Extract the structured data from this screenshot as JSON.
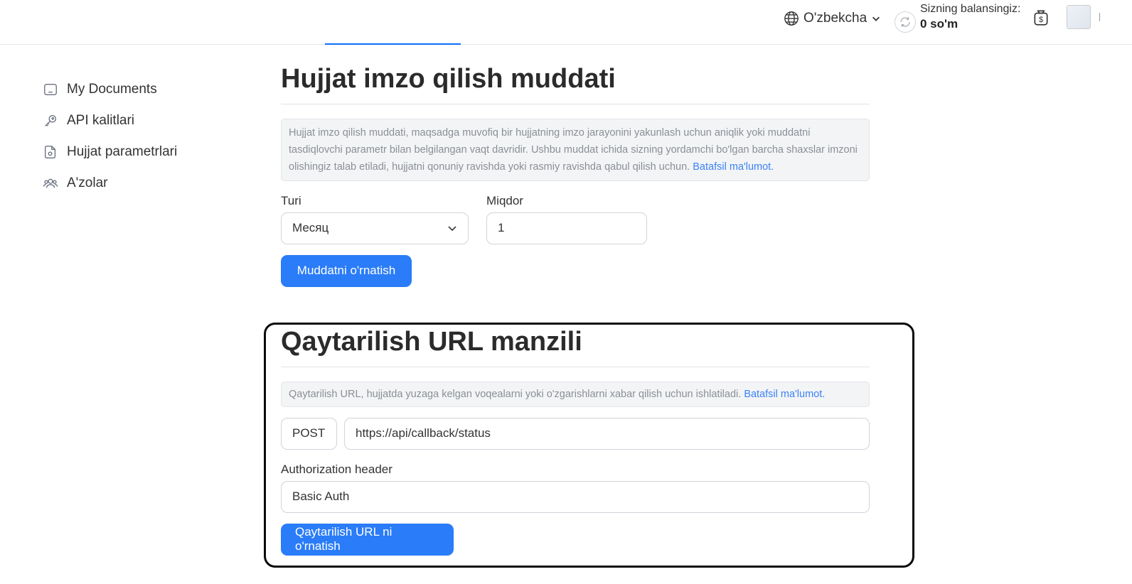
{
  "header": {
    "language": "O'zbekcha",
    "balance_label": "Sizning balansingiz:",
    "balance_value": "0 so'm"
  },
  "sidebar": {
    "items": [
      {
        "label": "My Documents",
        "icon": "document-icon"
      },
      {
        "label": "API kalitlari",
        "icon": "key-icon"
      },
      {
        "label": "Hujjat parametrlari",
        "icon": "document-settings-icon"
      },
      {
        "label": "A'zolar",
        "icon": "users-icon"
      }
    ]
  },
  "deadline": {
    "title": "Hujjat imzo qilish muddati",
    "info_text": "Hujjat imzo qilish muddati, maqsadga muvofiq bir hujjatning imzo jarayonini yakunlash uchun aniqlik yoki muddatni tasdiqlovchi parametr bilan belgilangan vaqt davridir. Ushbu muddat ichida sizning yordamchi bo'lgan barcha shaxslar imzoni olishingiz talab etiladi, hujjatni qonuniy ravishda yoki rasmiy ravishda qabul qilish uchun.",
    "info_link": "Batafsil ma'lumot.",
    "type_label": "Turi",
    "type_value": "Месяц",
    "amount_label": "Miqdor",
    "amount_value": "1",
    "submit_label": "Muddatni o'rnatish"
  },
  "callback": {
    "title": "Qaytarilish URL manzili",
    "info_text": "Qaytarilish URL, hujjatda yuzaga kelgan voqealarni yoki o'zgarishlarni xabar qilish uchun ishlatiladi.",
    "info_link": "Batafsil ma'lumot.",
    "method": "POST",
    "url_value": "https://api/callback/status",
    "auth_label": "Authorization header",
    "auth_value": "Basic Auth",
    "submit_label": "Qaytarilish URL ni o'rnatish"
  },
  "colors": {
    "accent": "#2a7cf8",
    "link": "#3b82f6",
    "info_bg": "#f3f4f6"
  }
}
